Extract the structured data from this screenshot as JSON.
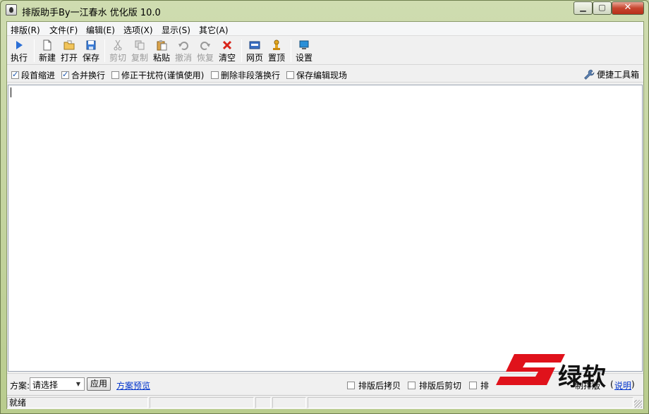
{
  "window": {
    "title": "排版助手By一江春水 优化版 10.0",
    "controls": {
      "minimize": "▁",
      "maximize": "▢",
      "close": "✕"
    }
  },
  "menubar": {
    "items": [
      "排版(R)",
      "文件(F)",
      "编辑(E)",
      "选项(X)",
      "显示(S)",
      "其它(A)"
    ]
  },
  "toolbar": {
    "buttons": [
      {
        "label": "执行",
        "icon": "play-icon",
        "enabled": true
      },
      {
        "label": "新建",
        "icon": "new-document-icon",
        "enabled": true
      },
      {
        "label": "打开",
        "icon": "open-folder-icon",
        "enabled": true
      },
      {
        "label": "保存",
        "icon": "save-disk-icon",
        "enabled": true
      },
      {
        "label": "剪切",
        "icon": "scissors-icon",
        "enabled": false
      },
      {
        "label": "复制",
        "icon": "copy-icon",
        "enabled": false
      },
      {
        "label": "粘贴",
        "icon": "paste-icon",
        "enabled": true
      },
      {
        "label": "撤消",
        "icon": "undo-icon",
        "enabled": false
      },
      {
        "label": "恢复",
        "icon": "redo-icon",
        "enabled": false
      },
      {
        "label": "清空",
        "icon": "clear-x-icon",
        "enabled": true
      },
      {
        "label": "网页",
        "icon": "html-icon",
        "enabled": true
      },
      {
        "label": "置顶",
        "icon": "pin-icon",
        "enabled": true
      },
      {
        "label": "设置",
        "icon": "settings-monitor-icon",
        "enabled": true
      }
    ]
  },
  "options": {
    "checkboxes": [
      {
        "label": "段首缩进",
        "checked": true
      },
      {
        "label": "合并换行",
        "checked": true
      },
      {
        "label": "修正干扰符(谨慎使用)",
        "checked": false
      },
      {
        "label": "删除非段落换行",
        "checked": false
      },
      {
        "label": "保存编辑现场",
        "checked": false
      }
    ],
    "toolbox_label": "便捷工具箱"
  },
  "editor": {
    "content": ""
  },
  "scheme": {
    "label": "方案:",
    "select_value": "请选择",
    "apply_label": "应用",
    "preview_link": "方案预览",
    "checkboxes": [
      {
        "label": "排版后拷贝",
        "checked": false
      },
      {
        "label": "排版后剪切",
        "checked": false
      },
      {
        "label": "排",
        "checked": false
      }
    ],
    "tail_text": "制排版",
    "help_link": "说明"
  },
  "statusbar": {
    "status": "就绪"
  },
  "watermark": {
    "text": "绿软",
    "letter": "S"
  },
  "colors": {
    "titlebar": "#c9d7a8",
    "close_button": "#c7452f",
    "link": "#0033cc",
    "watermark": "#e0121b"
  }
}
